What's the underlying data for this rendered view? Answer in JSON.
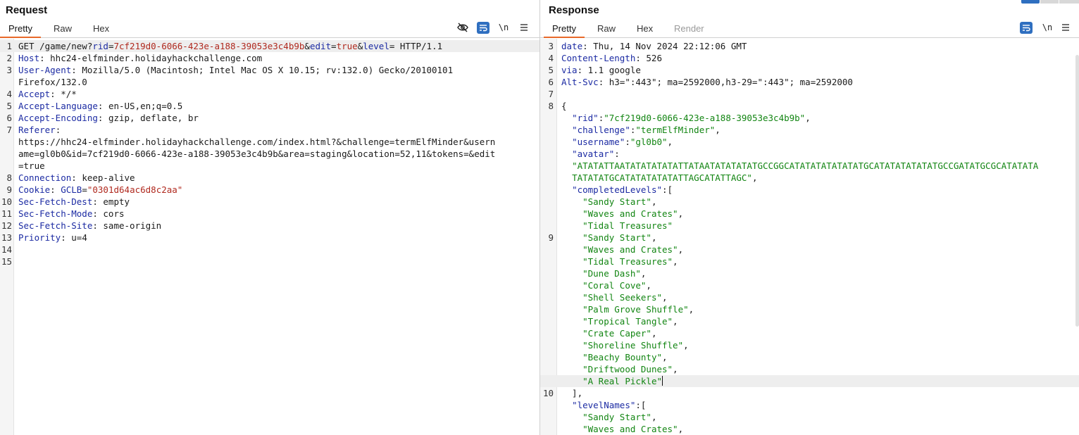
{
  "request": {
    "title": "Request",
    "tabs": [
      "Pretty",
      "Raw",
      "Hex"
    ],
    "icons": [
      "eye-slash-icon",
      "wrap-text-icon",
      "newline-icon",
      "menu-icon"
    ],
    "newline_label": "\\n",
    "lines": [
      {
        "n": "1",
        "hl": true,
        "parts": [
          [
            "p",
            "GET /game/new?"
          ],
          [
            "k",
            "rid"
          ],
          [
            "p",
            "="
          ],
          [
            "v",
            "7cf219d0-6066-423e-a188-39053e3c4b9b"
          ],
          [
            "p",
            "&"
          ],
          [
            "k",
            "edit"
          ],
          [
            "p",
            "="
          ],
          [
            "v",
            "true"
          ],
          [
            "p",
            "&"
          ],
          [
            "k",
            "level"
          ],
          [
            "p",
            "= HTTP/1.1"
          ]
        ]
      },
      {
        "n": "2",
        "parts": [
          [
            "k",
            "Host"
          ],
          [
            "p",
            ": hhc24-elfminder.holidayhackchallenge.com"
          ]
        ]
      },
      {
        "n": "3",
        "parts": [
          [
            "k",
            "User-Agent"
          ],
          [
            "p",
            ": Mozilla/5.0 (Macintosh; Intel Mac OS X 10.15; rv:132.0) Gecko/20100101"
          ]
        ]
      },
      {
        "n": "",
        "parts": [
          [
            "p",
            "Firefox/132.0"
          ]
        ]
      },
      {
        "n": "4",
        "parts": [
          [
            "k",
            "Accept"
          ],
          [
            "p",
            ": */*"
          ]
        ]
      },
      {
        "n": "5",
        "parts": [
          [
            "k",
            "Accept-Language"
          ],
          [
            "p",
            ": en-US,en;q=0.5"
          ]
        ]
      },
      {
        "n": "6",
        "parts": [
          [
            "k",
            "Accept-Encoding"
          ],
          [
            "p",
            ": gzip, deflate, br"
          ]
        ]
      },
      {
        "n": "7",
        "parts": [
          [
            "k",
            "Referer"
          ],
          [
            "p",
            ":"
          ]
        ]
      },
      {
        "n": "",
        "parts": [
          [
            "p",
            "https://hhc24-elfminder.holidayhackchallenge.com/index.html?&challenge=termElfMinder&usern"
          ]
        ]
      },
      {
        "n": "",
        "parts": [
          [
            "p",
            "ame=gl0b0&id=7cf219d0-6066-423e-a188-39053e3c4b9b&area=staging&location=52,11&tokens=&edit"
          ]
        ]
      },
      {
        "n": "",
        "parts": [
          [
            "p",
            "=true"
          ]
        ]
      },
      {
        "n": "8",
        "parts": [
          [
            "k",
            "Connection"
          ],
          [
            "p",
            ": keep-alive"
          ]
        ]
      },
      {
        "n": "9",
        "parts": [
          [
            "k",
            "Cookie"
          ],
          [
            "p",
            ": "
          ],
          [
            "k",
            "GCLB"
          ],
          [
            "p",
            "="
          ],
          [
            "v",
            "\"0301d64ac6d8c2aa\""
          ]
        ]
      },
      {
        "n": "10",
        "parts": [
          [
            "k",
            "Sec-Fetch-Dest"
          ],
          [
            "p",
            ": empty"
          ]
        ]
      },
      {
        "n": "11",
        "parts": [
          [
            "k",
            "Sec-Fetch-Mode"
          ],
          [
            "p",
            ": cors"
          ]
        ]
      },
      {
        "n": "12",
        "parts": [
          [
            "k",
            "Sec-Fetch-Site"
          ],
          [
            "p",
            ": same-origin"
          ]
        ]
      },
      {
        "n": "13",
        "parts": [
          [
            "k",
            "Priority"
          ],
          [
            "p",
            ": u=4"
          ]
        ]
      },
      {
        "n": "14",
        "parts": []
      },
      {
        "n": "15",
        "parts": []
      }
    ]
  },
  "response": {
    "title": "Response",
    "tabs": [
      "Pretty",
      "Raw",
      "Hex",
      "Render"
    ],
    "icons": [
      "wrap-text-icon",
      "newline-icon",
      "menu-icon"
    ],
    "newline_label": "\\n",
    "lines": [
      {
        "n": "3",
        "parts": [
          [
            "k",
            "date"
          ],
          [
            "p",
            ": Thu, 14 Nov 2024 22:12:06 GMT"
          ]
        ]
      },
      {
        "n": "4",
        "parts": [
          [
            "k",
            "Content-Length"
          ],
          [
            "p",
            ": 526"
          ]
        ]
      },
      {
        "n": "5",
        "parts": [
          [
            "k",
            "via"
          ],
          [
            "p",
            ": 1.1 google"
          ]
        ]
      },
      {
        "n": "6",
        "parts": [
          [
            "k",
            "Alt-Svc"
          ],
          [
            "p",
            ": h3=\":443\"; ma=2592000,h3-29=\":443\"; ma=2592000"
          ]
        ]
      },
      {
        "n": "7",
        "parts": []
      },
      {
        "n": "8",
        "parts": [
          [
            "p",
            "{"
          ]
        ]
      },
      {
        "n": "",
        "parts": [
          [
            "p",
            "  "
          ],
          [
            "k",
            "\"rid\""
          ],
          [
            "p",
            ":"
          ],
          [
            "s",
            "\"7cf219d0-6066-423e-a188-39053e3c4b9b\""
          ],
          [
            "p",
            ","
          ]
        ]
      },
      {
        "n": "",
        "parts": [
          [
            "p",
            "  "
          ],
          [
            "k",
            "\"challenge\""
          ],
          [
            "p",
            ":"
          ],
          [
            "s",
            "\"termElfMinder\""
          ],
          [
            "p",
            ","
          ]
        ]
      },
      {
        "n": "",
        "parts": [
          [
            "p",
            "  "
          ],
          [
            "k",
            "\"username\""
          ],
          [
            "p",
            ":"
          ],
          [
            "s",
            "\"gl0b0\""
          ],
          [
            "p",
            ","
          ]
        ]
      },
      {
        "n": "",
        "parts": [
          [
            "p",
            "  "
          ],
          [
            "k",
            "\"avatar\""
          ],
          [
            "p",
            ":"
          ]
        ]
      },
      {
        "n": "",
        "parts": [
          [
            "p",
            "  "
          ],
          [
            "s",
            "\"ATATATTAATATATATATATTATAATATATATATGCCGGCATATATATATATATGCATATATATATATGCCGATATGCGCATATATA"
          ]
        ]
      },
      {
        "n": "",
        "parts": [
          [
            "p",
            "  "
          ],
          [
            "s",
            "TATATATGCATATATATATATTAGCATATTAGC\""
          ],
          [
            "p",
            ","
          ]
        ]
      },
      {
        "n": "",
        "parts": [
          [
            "p",
            "  "
          ],
          [
            "k",
            "\"completedLevels\""
          ],
          [
            "p",
            ":["
          ]
        ]
      },
      {
        "n": "",
        "parts": [
          [
            "p",
            "    "
          ],
          [
            "s",
            "\"Sandy Start\""
          ],
          [
            "p",
            ","
          ]
        ]
      },
      {
        "n": "",
        "parts": [
          [
            "p",
            "    "
          ],
          [
            "s",
            "\"Waves and Crates\""
          ],
          [
            "p",
            ","
          ]
        ]
      },
      {
        "n": "",
        "parts": [
          [
            "p",
            "    "
          ],
          [
            "s",
            "\"Tidal Treasures\""
          ]
        ]
      },
      {
        "n": "9",
        "parts": [
          [
            "p",
            "    "
          ],
          [
            "s",
            "\"Sandy Start\""
          ],
          [
            "p",
            ","
          ]
        ]
      },
      {
        "n": "",
        "parts": [
          [
            "p",
            "    "
          ],
          [
            "s",
            "\"Waves and Crates\""
          ],
          [
            "p",
            ","
          ]
        ]
      },
      {
        "n": "",
        "parts": [
          [
            "p",
            "    "
          ],
          [
            "s",
            "\"Tidal Treasures\""
          ],
          [
            "p",
            ","
          ]
        ]
      },
      {
        "n": "",
        "parts": [
          [
            "p",
            "    "
          ],
          [
            "s",
            "\"Dune Dash\""
          ],
          [
            "p",
            ","
          ]
        ]
      },
      {
        "n": "",
        "parts": [
          [
            "p",
            "    "
          ],
          [
            "s",
            "\"Coral Cove\""
          ],
          [
            "p",
            ","
          ]
        ]
      },
      {
        "n": "",
        "parts": [
          [
            "p",
            "    "
          ],
          [
            "s",
            "\"Shell Seekers\""
          ],
          [
            "p",
            ","
          ]
        ]
      },
      {
        "n": "",
        "parts": [
          [
            "p",
            "    "
          ],
          [
            "s",
            "\"Palm Grove Shuffle\""
          ],
          [
            "p",
            ","
          ]
        ]
      },
      {
        "n": "",
        "parts": [
          [
            "p",
            "    "
          ],
          [
            "s",
            "\"Tropical Tangle\""
          ],
          [
            "p",
            ","
          ]
        ]
      },
      {
        "n": "",
        "parts": [
          [
            "p",
            "    "
          ],
          [
            "s",
            "\"Crate Caper\""
          ],
          [
            "p",
            ","
          ]
        ]
      },
      {
        "n": "",
        "parts": [
          [
            "p",
            "    "
          ],
          [
            "s",
            "\"Shoreline Shuffle\""
          ],
          [
            "p",
            ","
          ]
        ]
      },
      {
        "n": "",
        "parts": [
          [
            "p",
            "    "
          ],
          [
            "s",
            "\"Beachy Bounty\""
          ],
          [
            "p",
            ","
          ]
        ]
      },
      {
        "n": "",
        "parts": [
          [
            "p",
            "    "
          ],
          [
            "s",
            "\"Driftwood Dunes\""
          ],
          [
            "p",
            ","
          ]
        ]
      },
      {
        "n": "",
        "hl": true,
        "caret": true,
        "parts": [
          [
            "p",
            "    "
          ],
          [
            "s",
            "\"A Real Pickle\""
          ]
        ]
      },
      {
        "n": "10",
        "parts": [
          [
            "p",
            "  ],"
          ]
        ]
      },
      {
        "n": "",
        "parts": [
          [
            "p",
            "  "
          ],
          [
            "k",
            "\"levelNames\""
          ],
          [
            "p",
            ":["
          ]
        ]
      },
      {
        "n": "",
        "parts": [
          [
            "p",
            "    "
          ],
          [
            "s",
            "\"Sandy Start\""
          ],
          [
            "p",
            ","
          ]
        ]
      },
      {
        "n": "",
        "parts": [
          [
            "p",
            "    "
          ],
          [
            "s",
            "\"Waves and Crates\""
          ],
          [
            "p",
            ","
          ]
        ]
      }
    ]
  }
}
